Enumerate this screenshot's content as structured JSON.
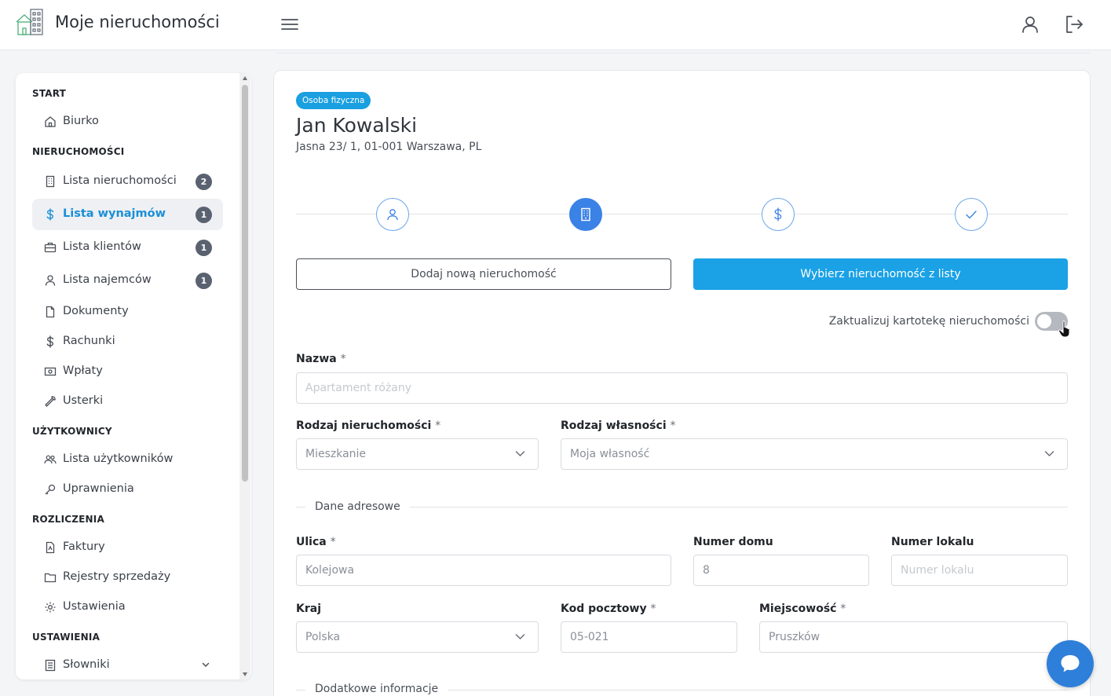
{
  "header": {
    "app_title": "Moje nieruchomości",
    "icons": [
      "building-logo-icon",
      "menu-icon",
      "user-icon",
      "logout-icon"
    ]
  },
  "sidebar": {
    "sections": [
      {
        "title": "START",
        "items": [
          {
            "label": "Biurko",
            "icon": "home-icon"
          }
        ]
      },
      {
        "title": "NIERUCHOMOŚCI",
        "items": [
          {
            "label": "Lista nieruchomości",
            "icon": "building-icon",
            "badge": "2"
          },
          {
            "label": "Lista wynajmów",
            "icon": "dollar-icon",
            "badge": "1",
            "active": true
          },
          {
            "label": "Lista klientów",
            "icon": "briefcase-icon",
            "badge": "1"
          },
          {
            "label": "Lista najemców",
            "icon": "user-icon",
            "badge": "1"
          },
          {
            "label": "Dokumenty",
            "icon": "document-icon"
          },
          {
            "label": "Rachunki",
            "icon": "dollar-icon"
          },
          {
            "label": "Wpłaty",
            "icon": "cash-icon"
          },
          {
            "label": "Usterki",
            "icon": "wrench-icon"
          }
        ]
      },
      {
        "title": "UŻYTKOWNICY",
        "items": [
          {
            "label": "Lista użytkowników",
            "icon": "users-icon"
          },
          {
            "label": "Uprawnienia",
            "icon": "key-icon"
          }
        ]
      },
      {
        "title": "ROZLICZENIA",
        "items": [
          {
            "label": "Faktury",
            "icon": "invoice-icon"
          },
          {
            "label": "Rejestry sprzedaży",
            "icon": "folder-icon"
          },
          {
            "label": "Ustawienia",
            "icon": "gear-icon"
          }
        ]
      },
      {
        "title": "USTAWIENIA",
        "items": [
          {
            "label": "Słowniki",
            "icon": "book-icon",
            "expandable": true
          }
        ]
      }
    ]
  },
  "client": {
    "type_badge": "Osoba fizyczna",
    "name": "Jan Kowalski",
    "address": "Jasna 23/ 1, 01-001 Warszawa, PL"
  },
  "stepper": {
    "steps": [
      {
        "icon": "user-icon"
      },
      {
        "icon": "building-icon",
        "active": true
      },
      {
        "icon": "dollar-icon"
      },
      {
        "icon": "check-icon"
      }
    ]
  },
  "actions": {
    "add_new": "Dodaj nową nieruchomość",
    "choose_from_list": "Wybierz nieruchomość z listy"
  },
  "toggle": {
    "label": "Zaktualizuj kartotekę nieruchomości",
    "on": false
  },
  "form": {
    "nazwa": {
      "label": "Nazwa",
      "required": "*",
      "placeholder": "Apartament różany"
    },
    "rodzaj_nieruchomosci": {
      "label": "Rodzaj nieruchomości",
      "required": "*",
      "value": "Mieszkanie"
    },
    "rodzaj_wlasnosci": {
      "label": "Rodzaj własności",
      "required": "*",
      "value": "Moja własność"
    },
    "section_address": "Dane adresowe",
    "ulica": {
      "label": "Ulica",
      "required": "*",
      "value": "Kolejowa"
    },
    "numer_domu": {
      "label": "Numer domu",
      "value": "8"
    },
    "numer_lokalu": {
      "label": "Numer lokalu",
      "placeholder": "Numer lokalu"
    },
    "kraj": {
      "label": "Kraj",
      "value": "Polska"
    },
    "kod_pocztowy": {
      "label": "Kod pocztowy",
      "required": "*",
      "value": "05-021"
    },
    "miejscowosc": {
      "label": "Miejscowość",
      "required": "*",
      "value": "Pruszków"
    },
    "section_extra": "Dodatkowe informacje"
  },
  "colors": {
    "primary": "#1aa1e6",
    "step_active": "#3b82e6",
    "badge": "#5a6170",
    "active_link": "#1a8fd6",
    "chat": "#2e7fd9"
  }
}
